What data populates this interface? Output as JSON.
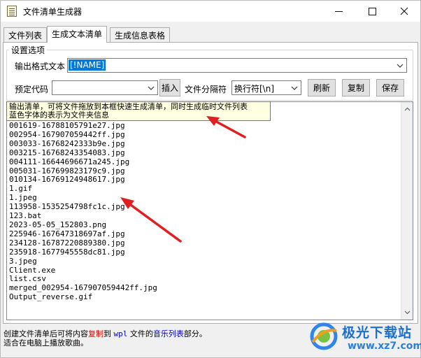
{
  "window": {
    "title": "文件清单生成器"
  },
  "tabs": [
    {
      "label": "文件列表",
      "active": false
    },
    {
      "label": "生成文本清单",
      "active": true
    },
    {
      "label": "生成信息表格",
      "active": false
    }
  ],
  "settings": {
    "group_label": "设置选项",
    "format_label": "输出格式文本",
    "format_value": "[!NAME]",
    "preset_label": "预定代码",
    "preset_value": "",
    "insert_label": "插入",
    "separator_label": "文件分隔符",
    "separator_value": "换行符[\\n]",
    "refresh_label": "刷新",
    "copy_label": "复制",
    "save_label": "保存"
  },
  "tooltip": {
    "line1": "输出清单，可将文件拖放到本框快速生成清单，同时生成临时文件列表",
    "line2": "蓝色字体的表示为文件夹信息"
  },
  "file_list": [
    "001619-16788105791e27.jpg",
    "002954-167907059442ff.jpg",
    "003033-16768242333b9e.jpg",
    "003215-16768243354083.jpg",
    "004111-16644696671a245.jpg",
    "005031-167699823179c9.jpg",
    "010134-16769124948617.jpg",
    "1.gif",
    "1.jpeg",
    "113958-1535254798fc1c.jpg",
    "123.bat",
    "2023-05-05_152803.png",
    "225946-167647318697af.jpg",
    "234128-16787220889380.jpg",
    "235918-1677945558dc81.jpg",
    "3.jpeg",
    "Client.exe",
    "list.csv",
    "merged_002954-167907059442ff.jpg",
    "Output_reverse.gif"
  ],
  "status": {
    "part1": "创建文件清单后可将内容",
    "part2": "复制",
    "part3": "到 ",
    "part4": "wpl",
    "part5": " 文件的",
    "part6": "音乐列表",
    "part7": "部分。",
    "line2": "适合在电脑上播放歌曲。"
  },
  "watermark": {
    "title": "极光下载站",
    "url": "www.xz7.com"
  },
  "colors": {
    "selection": "#0078d7",
    "tooltip_bg": "#ffffe1",
    "arrow_red": "#e02020",
    "status_red": "#d40000",
    "status_blue": "#0000cc"
  }
}
